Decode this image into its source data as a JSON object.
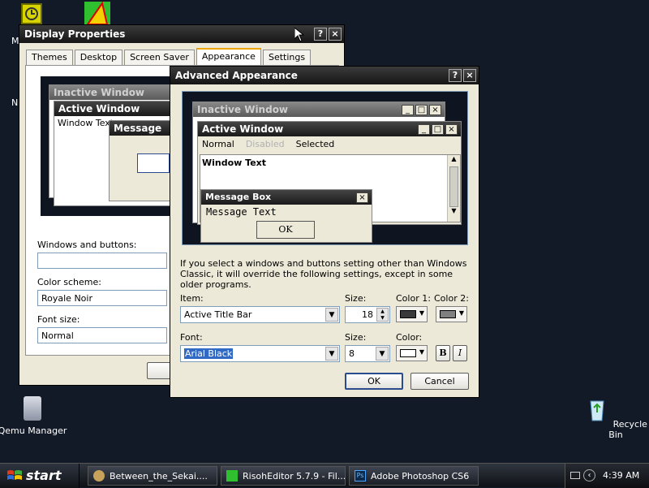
{
  "desktop": {
    "icons": [
      {
        "label": "Qemu Manager"
      },
      {
        "label": "Recycle Bin"
      }
    ],
    "partial_labels": [
      "M",
      "N"
    ]
  },
  "display_properties": {
    "title": "Display Properties",
    "tabs": [
      "Themes",
      "Desktop",
      "Screen Saver",
      "Appearance",
      "Settings"
    ],
    "active_tab": "Appearance",
    "preview": {
      "inactive_title": "Inactive Window",
      "active_title": "Active Window",
      "window_text": "Window Text",
      "message_title": "Message"
    },
    "windows_buttons_label": "Windows and buttons:",
    "windows_buttons_value": "",
    "color_scheme_label": "Color scheme:",
    "color_scheme_value": "Royale Noir",
    "font_size_label": "Font size:",
    "font_size_value": "Normal"
  },
  "advanced": {
    "title": "Advanced Appearance",
    "help_btn": "?",
    "close_btn": "×",
    "preview": {
      "inactive_title": "Inactive Window",
      "active_title": "Active Window",
      "menu": [
        "Normal",
        "Disabled",
        "Selected"
      ],
      "window_text": "Window Text",
      "msgbox_title": "Message Box",
      "msgbox_text": "Message Text",
      "ok": "OK"
    },
    "info_text": "If you select a windows and buttons setting other than Windows Classic, it will override the following settings, except in some older programs.",
    "item_label": "Item:",
    "item_value": "Active Title Bar",
    "size_label": "Size:",
    "size_value": "18",
    "color1_label": "Color 1:",
    "color2_label": "Color 2:",
    "font_label": "Font:",
    "font_value": "Arial Black",
    "font_size_label": "Size:",
    "font_size_value": "8",
    "color_label": "Color:",
    "bold_label": "B",
    "italic_label": "I",
    "ok_label": "OK",
    "cancel_label": "Cancel",
    "colors": {
      "color1": "#3a3a3a",
      "color2": "#808080",
      "font_color": "#ffffff"
    }
  },
  "taskbar": {
    "start_label": "start",
    "tasks": [
      {
        "label": "Between_the_Sekai...."
      },
      {
        "label": "RisohEditor 5.7.9 - Fil..."
      },
      {
        "label": "Adobe Photoshop CS6"
      }
    ],
    "clock": "4:39 AM"
  }
}
